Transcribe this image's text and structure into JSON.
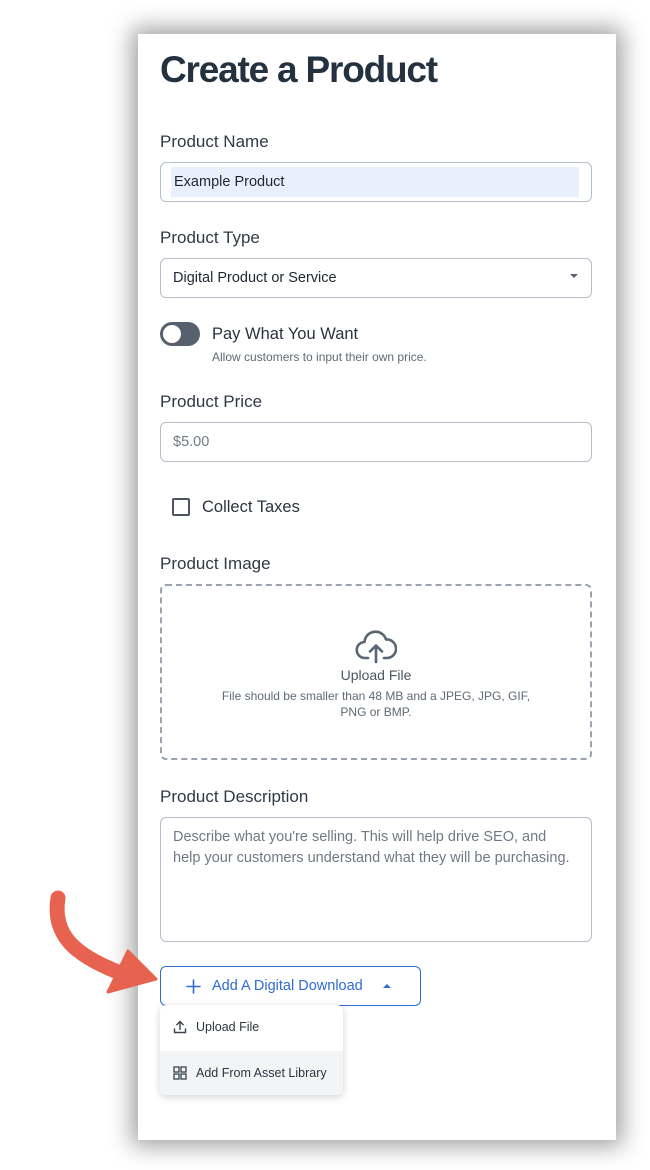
{
  "page": {
    "title": "Create a Product"
  },
  "form": {
    "product_name": {
      "label": "Product Name",
      "value": "Example Product"
    },
    "product_type": {
      "label": "Product Type",
      "value": "Digital Product or Service"
    },
    "pay_what_you_want": {
      "label": "Pay What You Want",
      "help": "Allow customers to input their own price.",
      "enabled": false
    },
    "product_price": {
      "label": "Product Price",
      "placeholder": "$5.00"
    },
    "collect_taxes": {
      "label": "Collect Taxes",
      "checked": false
    },
    "product_image": {
      "label": "Product Image",
      "upload_label": "Upload File",
      "hint_line1": "File should be smaller than 48 MB and a JPEG, JPG, GIF,",
      "hint_line2": "PNG or BMP."
    },
    "product_description": {
      "label": "Product Description",
      "placeholder": "Describe what you're selling. This will help drive SEO, and help your customers understand what they will be purchasing."
    }
  },
  "digital_download": {
    "button_label": "Add A Digital Download",
    "menu": [
      {
        "label": "Upload File",
        "icon": "upload-icon"
      },
      {
        "label": "Add From Asset Library",
        "icon": "grid-icon"
      }
    ]
  },
  "colors": {
    "accent": "#2f6bd4",
    "heading": "#243240",
    "annotation_arrow": "#e8634f",
    "autofill_bg": "#e8f0fe"
  }
}
